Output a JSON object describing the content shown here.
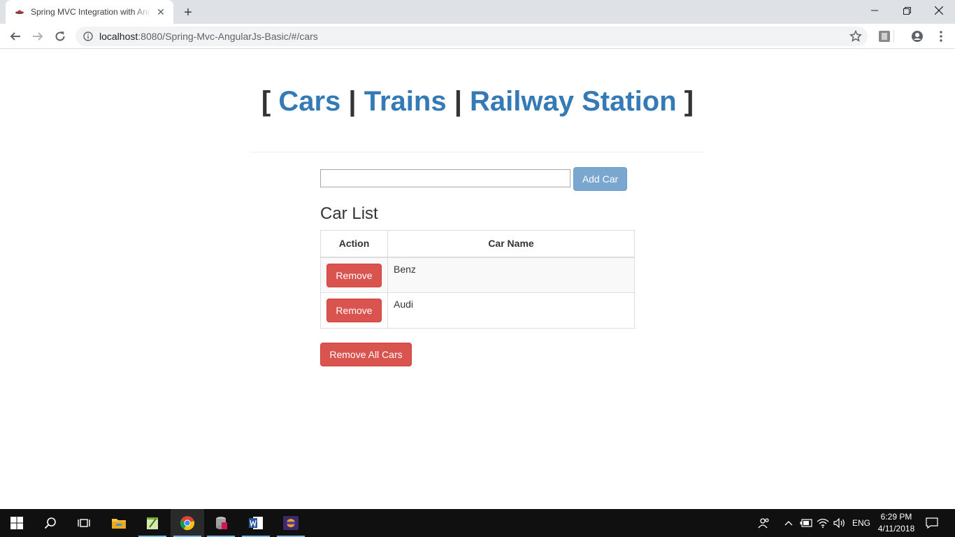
{
  "browser": {
    "tab_title": "Spring MVC Integration with AngularJS",
    "new_tab_symbol": "+",
    "url_host": "localhost",
    "url_rest": ":8080/Spring-Mvc-AngularJs-Basic/#/cars"
  },
  "page": {
    "nav": {
      "open_bracket": "[",
      "cars": "Cars",
      "sep1": "|",
      "trains": "Trains",
      "sep2": "|",
      "railway_station": "Railway Station",
      "close_bracket": "]"
    },
    "car_input": {
      "value": "",
      "placeholder": ""
    },
    "add_car_label": "Add Car",
    "list_title": "Car List",
    "table": {
      "headers": {
        "action": "Action",
        "car_name": "Car Name"
      },
      "rows": [
        {
          "remove_label": "Remove",
          "car_name": "Benz"
        },
        {
          "remove_label": "Remove",
          "car_name": "Audi"
        }
      ]
    },
    "remove_all_label": "Remove All Cars"
  },
  "taskbar": {
    "language": "ENG",
    "time": "6:29 PM",
    "date": "4/11/2018"
  },
  "colors": {
    "link": "#337ab7",
    "danger": "#d9534f",
    "primary_disabled": "#7aa7d0"
  }
}
